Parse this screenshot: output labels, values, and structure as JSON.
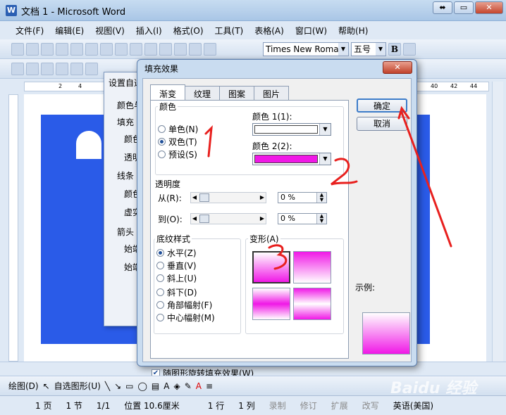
{
  "window": {
    "title": "文档 1 - Microsoft Word",
    "app_icon": "W",
    "min": "⬌",
    "restore": "▭",
    "close": "✕"
  },
  "menu": [
    "文件(F)",
    "编辑(E)",
    "视图(V)",
    "插入(I)",
    "格式(O)",
    "工具(T)",
    "表格(A)",
    "窗口(W)",
    "帮助(H)"
  ],
  "toolbar": {
    "font_name": "Times New Roman",
    "font_size": "五号",
    "bold": "B"
  },
  "ruler": {
    "ticks": [
      "2",
      "2",
      "4",
      "40",
      "42",
      "44"
    ]
  },
  "back_dialog": {
    "title": "设置自选",
    "labels": [
      "颜色与",
      "填充",
      "颜色",
      "透明",
      "线条",
      "颜色",
      "虚实",
      "箭头",
      "始端",
      "始端"
    ]
  },
  "dialog": {
    "title": "填充效果",
    "close": "✕",
    "tabs": [
      "渐变",
      "纹理",
      "图案",
      "图片"
    ],
    "colors_group": "颜色",
    "color_options": [
      {
        "label": "单色(N)",
        "selected": false
      },
      {
        "label": "双色(T)",
        "selected": true
      },
      {
        "label": "预设(S)",
        "selected": false
      }
    ],
    "color1_label": "颜色 1(1):",
    "color1_value": "#ffffff",
    "color2_label": "颜色 2(2):",
    "color2_value": "#f018e6",
    "transparency_group": "透明度",
    "from_label": "从(R):",
    "from_value": "0 %",
    "to_label": "到(O):",
    "to_value": "0 %",
    "style_group": "底纹样式",
    "styles": [
      {
        "label": "水平(Z)",
        "selected": true
      },
      {
        "label": "垂直(V)",
        "selected": false
      },
      {
        "label": "斜上(U)",
        "selected": false
      },
      {
        "label": "斜下(D)",
        "selected": false
      },
      {
        "label": "角部幅射(F)",
        "selected": false
      },
      {
        "label": "中心幅射(M)",
        "selected": false
      }
    ],
    "variants_group": "变形(A)",
    "sample_label": "示例:",
    "ok": "确定",
    "cancel": "取消",
    "rotate_checkbox": "随图形旋转填充效果(W)",
    "rotate_checked": true
  },
  "draw_toolbar": {
    "draw": "绘图(D)",
    "autoshapes": "自选图形(U)"
  },
  "status": {
    "page": "1 页",
    "section": "1 节",
    "pages": "1/1",
    "position": "位置 10.6厘米",
    "line": "1 行",
    "col": "1 列",
    "rec": "录制",
    "trk": "修订",
    "ext": "扩展",
    "ovr": "改写",
    "lang": "英语(美国)"
  },
  "annotations": {
    "n1": "1",
    "n2": "2",
    "n3": "3",
    "accent": "#e8201e"
  },
  "watermark": "Baidu 经验"
}
